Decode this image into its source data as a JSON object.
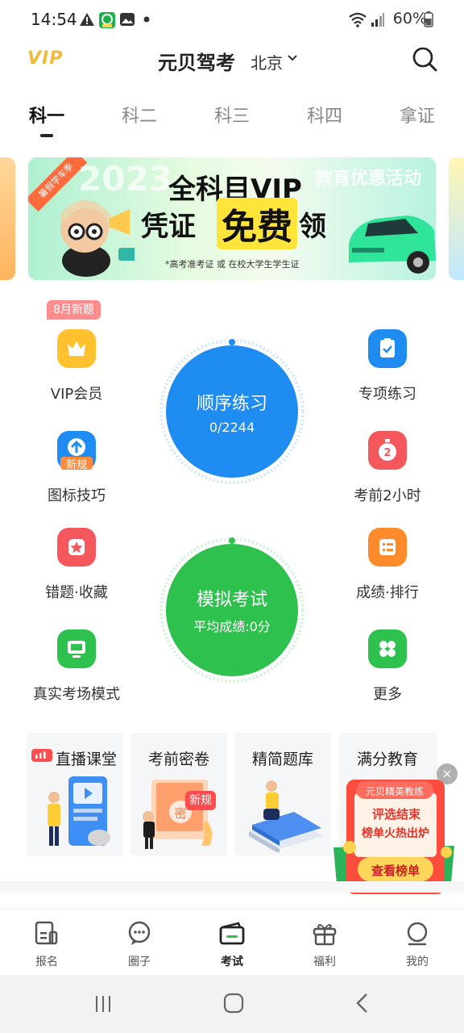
{
  "status_bar": {
    "time": "14:54",
    "battery": "60%",
    "icons": [
      "warning-icon",
      "app-notification-icon",
      "image-icon",
      "dot-icon",
      "wifi-icon",
      "signal-icon",
      "battery-icon"
    ]
  },
  "header": {
    "logo": "VIP",
    "title": "元贝驾考",
    "city": "北京"
  },
  "tabs": [
    {
      "label": "科一",
      "active": true
    },
    {
      "label": "科二",
      "active": false
    },
    {
      "label": "科三",
      "active": false
    },
    {
      "label": "科四",
      "active": false
    },
    {
      "label": "拿证",
      "active": false
    }
  ],
  "banner": {
    "ribbon": "暑假学车季",
    "year": "2023",
    "line1": "全科目VIP",
    "line2": "凭证",
    "free": "免费",
    "claim": "领",
    "edu": "教育优惠活动",
    "note": "*高考准考证 或 在校大学生学生证"
  },
  "features": {
    "badge": "8月新题",
    "left": [
      {
        "label": "VIP会员",
        "icon": "crown-icon"
      },
      {
        "label": "图标技巧",
        "icon": "upload-new-icon",
        "tag": "新规"
      },
      {
        "label": "错题·收藏",
        "icon": "star-icon"
      },
      {
        "label": "真实考场模式",
        "icon": "monitor-icon"
      }
    ],
    "right": [
      {
        "label": "专项练习",
        "icon": "clipboard-icon"
      },
      {
        "label": "考前2小时",
        "icon": "stopwatch-icon"
      },
      {
        "label": "成绩·排行",
        "icon": "list-icon"
      },
      {
        "label": "更多",
        "icon": "grid-icon"
      }
    ]
  },
  "practice": {
    "title": "顺序练习",
    "progress": "0/2244"
  },
  "exam": {
    "title": "模拟考试",
    "average": "平均成绩:0分"
  },
  "cards": [
    {
      "label": "直播课堂"
    },
    {
      "label": "考前密卷",
      "tag": "新规",
      "seal": "密"
    },
    {
      "label": "精简题库"
    },
    {
      "label": "满分教育"
    }
  ],
  "promo": {
    "top": "元贝精英教练",
    "line1": "评选结束",
    "line2": "榜单火热出炉",
    "button": "查看榜单"
  },
  "bottom_nav": [
    {
      "label": "报名",
      "icon": "document-icon",
      "active": false
    },
    {
      "label": "圈子",
      "icon": "chat-icon",
      "active": false
    },
    {
      "label": "考试",
      "icon": "wallet-icon",
      "active": true
    },
    {
      "label": "福利",
      "icon": "gift-icon",
      "active": false
    },
    {
      "label": "我的",
      "icon": "person-icon",
      "active": false
    }
  ]
}
